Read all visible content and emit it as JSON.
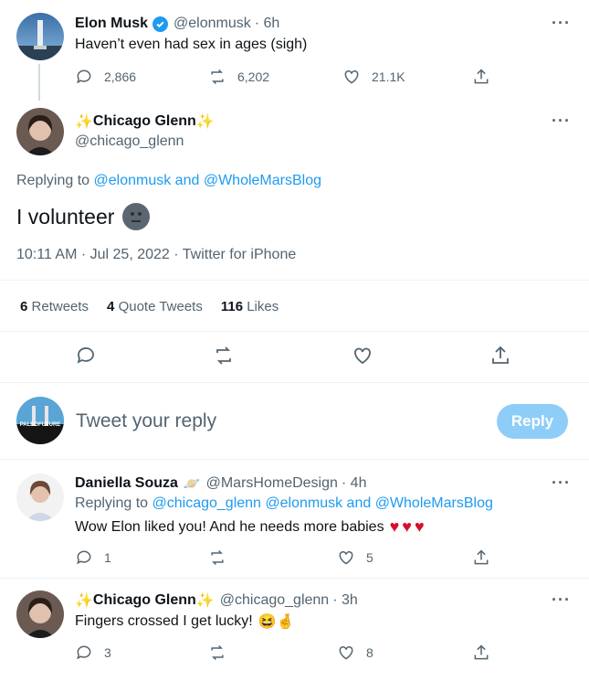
{
  "tweet_parent": {
    "name": "Elon Musk",
    "handle": "@elonmusk",
    "time": "· 6h",
    "text": "Haven’t even had sex in ages (sigh)",
    "replies": "2,866",
    "retweets": "6,202",
    "likes": "21.1K",
    "verified": true
  },
  "tweet_main": {
    "name_prefix": "✨",
    "name": "Chicago Glenn",
    "name_suffix": "✨",
    "handle": "@chicago_glenn",
    "replying_label": "Replying to",
    "replying_to": [
      "@elonmusk",
      "and",
      "@WholeMarsBlog"
    ],
    "text": "I volunteer",
    "meta": "10:11 AM · Jul 25, 2022 · Twitter for iPhone",
    "stats": {
      "retweets_count": "6",
      "retweets_label": "Retweets",
      "quotes_count": "4",
      "quotes_label": "Quote Tweets",
      "likes_count": "116",
      "likes_label": "Likes"
    }
  },
  "composer": {
    "avatar_text": "PALEOFUTURE",
    "placeholder": "Tweet your reply",
    "reply_button": "Reply"
  },
  "replies": [
    {
      "name": "Daniella Souza",
      "emoji": "🪐",
      "handle": "@MarsHomeDesign",
      "time": "· 4h",
      "replying_label": "Replying to",
      "replying_to": "@chicago_glenn @elonmusk and @WholeMarsBlog",
      "text": "Wow Elon liked you! And he needs more babies",
      "hearts": "♥♥♥",
      "replies": "1",
      "likes": "5"
    },
    {
      "name_prefix": "✨",
      "name": "Chicago Glenn",
      "name_suffix": "✨",
      "handle": "@chicago_glenn",
      "time": "· 3h",
      "text": "Fingers crossed I get lucky!",
      "emoji": "😆🤞",
      "replies": "3",
      "likes": "8"
    }
  ],
  "colors": {
    "link": "#1d9bf0",
    "muted": "#536471",
    "verified": "#1d9bf0",
    "reply_button": "#8ecdf8"
  }
}
